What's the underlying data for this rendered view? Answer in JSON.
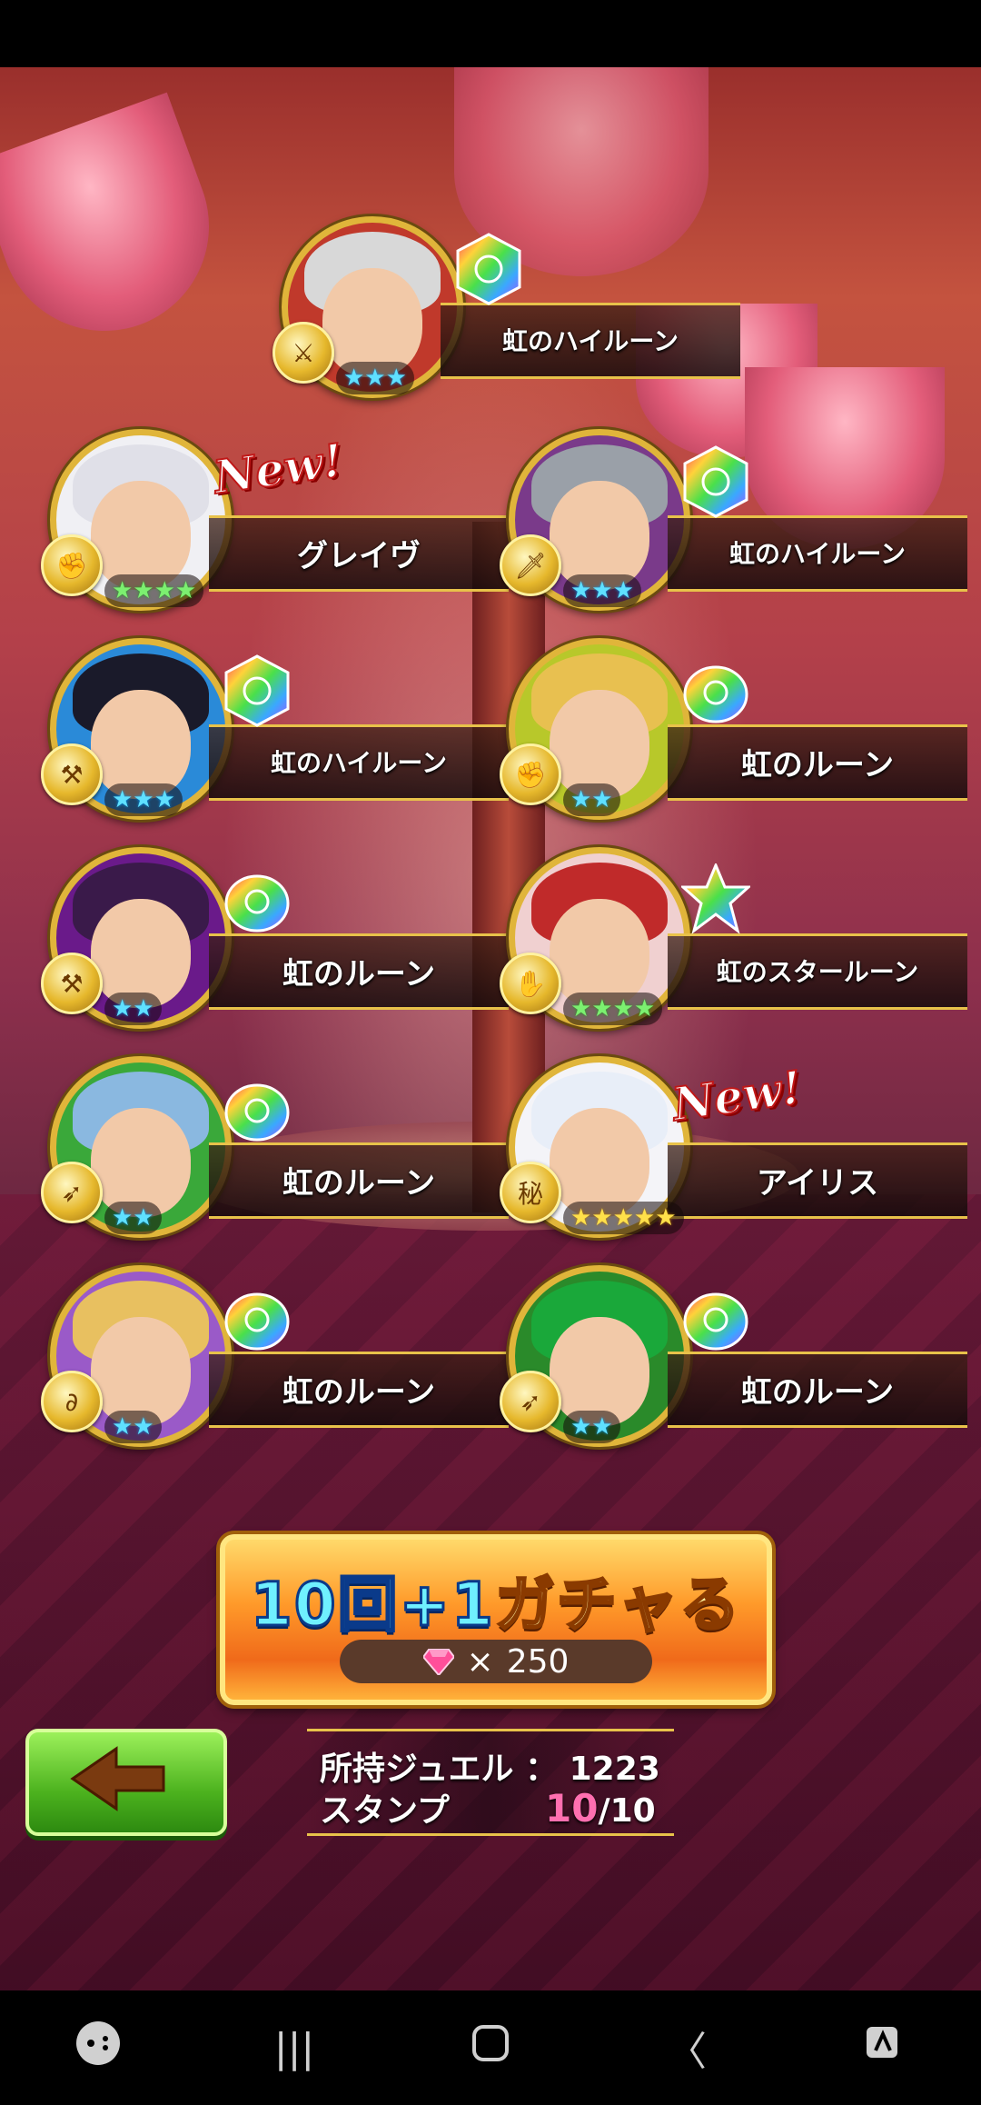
{
  "cards": [
    {
      "id": "top",
      "reward": "虹のハイルーン",
      "stars": "★★★",
      "star_color": "cyan",
      "new_label": "",
      "badge": "⚔",
      "hair_color": "#d8d8d8",
      "bg": "#c0392b",
      "rune": "rainbow-hex"
    },
    {
      "id": "l1",
      "reward": "グレイヴ",
      "stars": "★★★★",
      "star_color": "green",
      "new_label": "New!",
      "badge": "✊",
      "hair_color": "#e0e0e8",
      "bg": "#f0f0f4",
      "rune": ""
    },
    {
      "id": "r1",
      "reward": "虹のハイルーン",
      "stars": "★★★",
      "star_color": "cyan",
      "new_label": "",
      "badge": "🗡",
      "hair_color": "#9aa0a8",
      "bg": "#7a3a8a",
      "rune": "rainbow-hex"
    },
    {
      "id": "l2",
      "reward": "虹のハイルーン",
      "stars": "★★★",
      "star_color": "cyan",
      "new_label": "",
      "badge": "⚒",
      "hair_color": "#1a1a2a",
      "bg": "#2a8ad8",
      "rune": "rainbow-hex"
    },
    {
      "id": "r2",
      "reward": "虹のルーン",
      "stars": "★★",
      "star_color": "cyan",
      "new_label": "",
      "badge": "✊",
      "hair_color": "#e8c050",
      "bg": "#b8c82a",
      "rune": "rainbow-drop"
    },
    {
      "id": "l3",
      "reward": "虹のルーン",
      "stars": "★★",
      "star_color": "cyan",
      "new_label": "",
      "badge": "⚒",
      "hair_color": "#3a1a4a",
      "bg": "#6a1a8a",
      "rune": "rainbow-drop"
    },
    {
      "id": "r3",
      "reward": "虹のスタールーン",
      "stars": "★★★★",
      "star_color": "green",
      "new_label": "",
      "badge": "✋",
      "hair_color": "#c02a2a",
      "bg": "#f0d0d0",
      "rune": "rainbow-star"
    },
    {
      "id": "l4",
      "reward": "虹のルーン",
      "stars": "★★",
      "star_color": "cyan",
      "new_label": "",
      "badge": "➶",
      "hair_color": "#8ab8e0",
      "bg": "#3aa83a",
      "rune": "rainbow-drop"
    },
    {
      "id": "r4",
      "reward": "アイリス",
      "stars": "★★★★★",
      "star_color": "gold",
      "new_label": "New!",
      "badge": "秘",
      "hair_color": "#e8eef8",
      "bg": "#f4f4f8",
      "rune": ""
    },
    {
      "id": "l5",
      "reward": "虹のルーン",
      "stars": "★★",
      "star_color": "cyan",
      "new_label": "",
      "badge": "∂",
      "hair_color": "#e8c060",
      "bg": "#9a5ac8",
      "rune": "rainbow-drop"
    },
    {
      "id": "r5",
      "reward": "虹のルーン",
      "stars": "★★",
      "star_color": "cyan",
      "new_label": "",
      "badge": "➶",
      "hair_color": "#1aa83a",
      "bg": "#2a8a2a",
      "rune": "rainbow-drop"
    }
  ],
  "gacha": {
    "title_num": "10回+1",
    "title_jp": "ガチャる",
    "cost_x": "×",
    "cost": "250"
  },
  "info": {
    "jewel_label": "所持ジュエル",
    "jewel_sep": "：",
    "jewel_value": "1223",
    "stamp_label": "スタンプ",
    "stamp_current": "10",
    "stamp_total": "/10"
  },
  "nav": {
    "game_icon": "gamepad-icon",
    "recents": "|||",
    "home": "○",
    "back": "〈",
    "assistant_icon": "assist-icon"
  }
}
